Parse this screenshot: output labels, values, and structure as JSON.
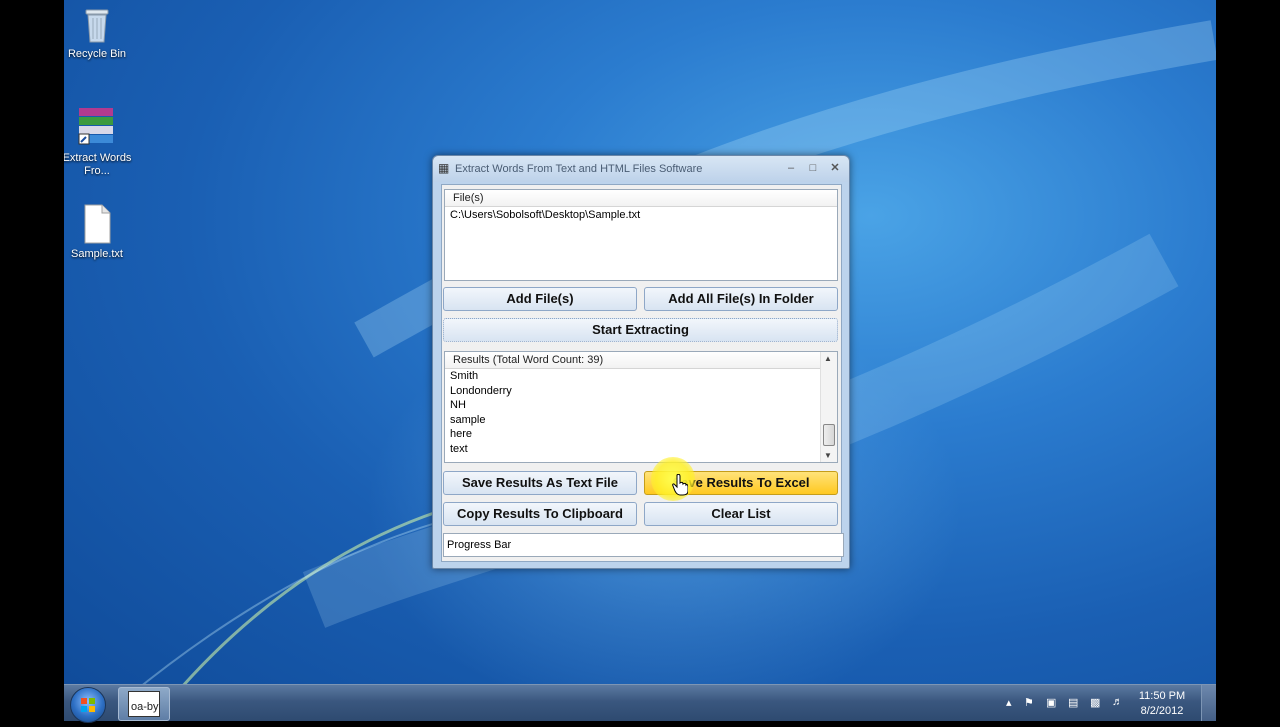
{
  "desktop": {
    "icons": [
      {
        "label": "Recycle Bin"
      },
      {
        "label": "Extract Words Fro..."
      },
      {
        "label": "Sample.txt"
      }
    ]
  },
  "window": {
    "title": "Extract Words From Text and HTML Files Software",
    "files_header": "File(s)",
    "files": [
      "C:\\Users\\Sobolsoft\\Desktop\\Sample.txt"
    ],
    "add_files_label": "Add File(s)",
    "add_folder_label": "Add All File(s) In Folder",
    "start_label": "Start Extracting",
    "results_header": "Results (Total Word Count: 39)",
    "results": [
      "Smith",
      "Londonderry",
      "NH",
      "sample",
      "here",
      "text"
    ],
    "save_text_label": "Save Results As Text File",
    "save_excel_label": "Save Results To Excel",
    "copy_label": "Copy Results To Clipboard",
    "clear_label": "Clear List",
    "progress_label": "Progress Bar"
  },
  "taskbar": {
    "app_label": "oa-by",
    "time": "11:50 PM",
    "date": "8/2/2012"
  },
  "colors": {
    "accent_hot": "#ffc820",
    "desktop_blue": "#1a5fb3"
  }
}
